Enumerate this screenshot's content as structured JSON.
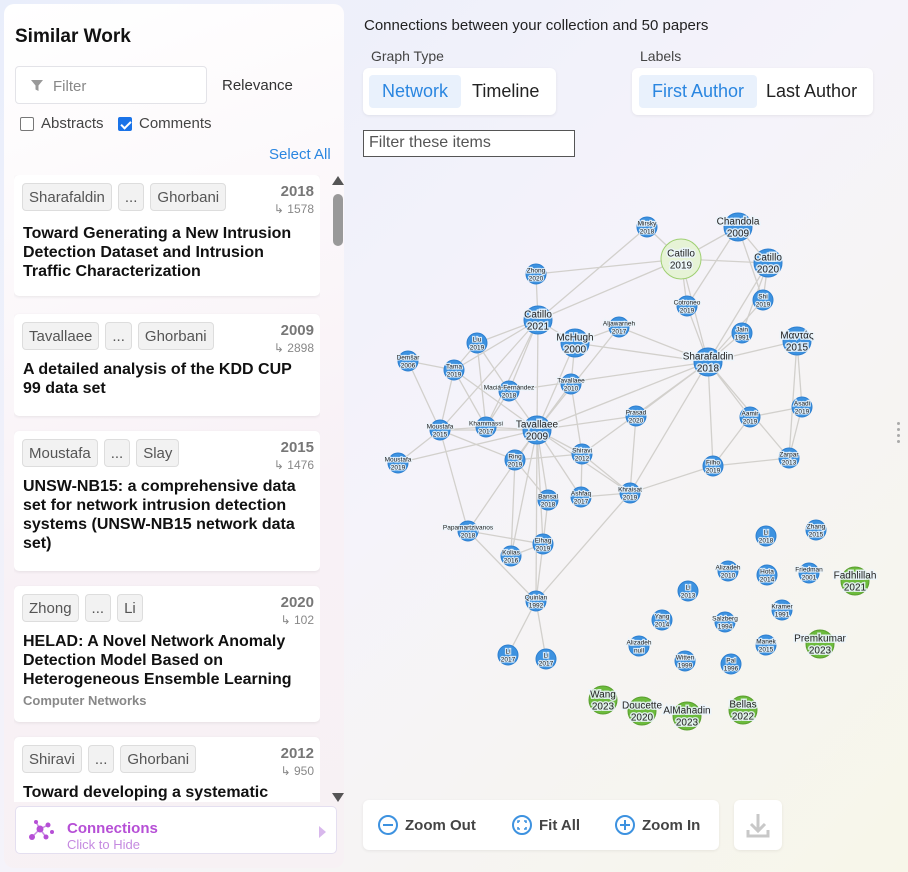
{
  "sidebar": {
    "title": "Similar Work",
    "filter_placeholder": "Filter",
    "sort_label": "Relevance",
    "abstracts_label": "Abstracts",
    "abstracts_checked": false,
    "comments_label": "Comments",
    "comments_checked": true,
    "select_all": "Select All",
    "cards": [
      {
        "first": "Sharafaldin",
        "ellipsis": "...",
        "last": "Ghorbani",
        "year": "2018",
        "cites": "↳ 1578",
        "title": "Toward Generating a New Intrusion Detection Dataset and Intrusion Traffic Characterization",
        "journal": ""
      },
      {
        "first": "Tavallaee",
        "ellipsis": "...",
        "last": "Ghorbani",
        "year": "2009",
        "cites": "↳ 2898",
        "title": "A detailed analysis of the KDD CUP 99 data set",
        "journal": ""
      },
      {
        "first": "Moustafa",
        "ellipsis": "...",
        "last": "Slay",
        "year": "2015",
        "cites": "↳ 1476",
        "title": "UNSW-NB15: a comprehensive data set for network intrusion detection systems (UNSW-NB15 network data set)",
        "journal": ""
      },
      {
        "first": "Zhong",
        "ellipsis": "...",
        "last": "Li",
        "year": "2020",
        "cites": "↳ 102",
        "title": "HELAD: A Novel Network Anomaly Detection Model Based on Heterogeneous Ensemble Learning",
        "journal": "Computer Networks"
      },
      {
        "first": "Shiravi",
        "ellipsis": "...",
        "last": "Ghorbani",
        "year": "2012",
        "cites": "↳ 950",
        "title": "Toward developing a systematic",
        "journal": ""
      }
    ],
    "connections": {
      "title": "Connections",
      "subtitle": "Click to Hide"
    }
  },
  "main": {
    "heading": "Connections between your collection and 50 papers",
    "graph_type_label": "Graph Type",
    "graph_types": [
      "Network",
      "Timeline"
    ],
    "graph_type_selected": "Network",
    "labels_label": "Labels",
    "label_options": [
      "First Author",
      "Last Author"
    ],
    "label_selected": "First Author",
    "filter_placeholder": "Filter these items",
    "zoom_out": "Zoom Out",
    "fit_all": "Fit All",
    "zoom_in": "Zoom In"
  },
  "colors": {
    "accent": "#2a86e0",
    "node_blue": "#3d92e0",
    "node_green": "#6cbb3c",
    "node_collection": "#e6f3d6",
    "connections_purple": "#b64fd6"
  },
  "graph": {
    "nodes": [
      {
        "id": "mirsky",
        "author": "Mirsky",
        "year": "2018",
        "kind": "b"
      },
      {
        "id": "chandola",
        "author": "Chandola",
        "year": "2009",
        "kind": "b"
      },
      {
        "id": "catillo19",
        "author": "Catillo",
        "year": "2019",
        "kind": "c"
      },
      {
        "id": "catillo20",
        "author": "Catillo",
        "year": "2020",
        "kind": "b"
      },
      {
        "id": "zhong",
        "author": "Zhong",
        "year": "2020",
        "kind": "b"
      },
      {
        "id": "shi",
        "author": "Shi",
        "year": "2019",
        "kind": "b"
      },
      {
        "id": "cotroneo",
        "author": "Cotroneo",
        "year": "2019",
        "kind": "b"
      },
      {
        "id": "catillo21",
        "author": "Catillo",
        "year": "2021",
        "kind": "b"
      },
      {
        "id": "aljawarneh",
        "author": "Aljawarneh",
        "year": "2017",
        "kind": "b"
      },
      {
        "id": "jain",
        "author": "Jain",
        "year": "1991",
        "kind": "b"
      },
      {
        "id": "mantas",
        "author": "Μαντάς",
        "year": "2015",
        "kind": "b"
      },
      {
        "id": "liu",
        "author": "Liu",
        "year": "2019",
        "kind": "b"
      },
      {
        "id": "mchugh",
        "author": "McHugh",
        "year": "2000",
        "kind": "b"
      },
      {
        "id": "sharafaldin",
        "author": "Sharafaldin",
        "year": "2018",
        "kind": "b"
      },
      {
        "id": "demsar",
        "author": "Demšar",
        "year": "2006",
        "kind": "b"
      },
      {
        "id": "tama",
        "author": "Tama",
        "year": "2019",
        "kind": "b"
      },
      {
        "id": "maciafernandez",
        "author": "Maciá-Fernández",
        "year": "2018",
        "kind": "b"
      },
      {
        "id": "tavallaee10",
        "author": "Tavallaee",
        "year": "2010",
        "kind": "b"
      },
      {
        "id": "prasad",
        "author": "Prasad",
        "year": "2020",
        "kind": "b"
      },
      {
        "id": "aamir",
        "author": "Aamir",
        "year": "2019",
        "kind": "b"
      },
      {
        "id": "asadi",
        "author": "Asadi",
        "year": "2019",
        "kind": "b"
      },
      {
        "id": "moustafa",
        "author": "Moustafa",
        "year": "2015",
        "kind": "b"
      },
      {
        "id": "khammassi",
        "author": "Khammassi",
        "year": "2017",
        "kind": "b"
      },
      {
        "id": "tavallaee09",
        "author": "Tavallaee",
        "year": "2009",
        "kind": "b"
      },
      {
        "id": "shiravi",
        "author": "Shiravi",
        "year": "2012",
        "kind": "b"
      },
      {
        "id": "zarpar",
        "author": "Zarpar",
        "year": "2013",
        "kind": "b"
      },
      {
        "id": "moustafa19",
        "author": "Moustafa",
        "year": "2019",
        "kind": "b"
      },
      {
        "id": "ring",
        "author": "Ring",
        "year": "2019",
        "kind": "b"
      },
      {
        "id": "filho",
        "author": "Filho",
        "year": "2019",
        "kind": "b"
      },
      {
        "id": "bansal",
        "author": "Bansal",
        "year": "2018",
        "kind": "b"
      },
      {
        "id": "ashfaq",
        "author": "Ashfaq",
        "year": "2017",
        "kind": "b"
      },
      {
        "id": "khraisat",
        "author": "Khraisat",
        "year": "2019",
        "kind": "b"
      },
      {
        "id": "papamartzivanos",
        "author": "Papamartzivanos",
        "year": "2018",
        "kind": "b"
      },
      {
        "id": "elhag",
        "author": "Elhag",
        "year": "2019",
        "kind": "b"
      },
      {
        "id": "li18",
        "author": "Li",
        "year": "2018",
        "kind": "b"
      },
      {
        "id": "zhang",
        "author": "Zhang",
        "year": "2015",
        "kind": "b"
      },
      {
        "id": "kolias",
        "author": "Kolias",
        "year": "2016",
        "kind": "b"
      },
      {
        "id": "alizadeh10",
        "author": "Alizadeh",
        "year": "2010",
        "kind": "b"
      },
      {
        "id": "hota",
        "author": "Hota",
        "year": "2014",
        "kind": "b"
      },
      {
        "id": "friedman",
        "author": "Friedman",
        "year": "2001",
        "kind": "b"
      },
      {
        "id": "fadhlillah",
        "author": "Fadhlillah",
        "year": "2021",
        "kind": "g"
      },
      {
        "id": "li13",
        "author": "Li",
        "year": "2013",
        "kind": "b"
      },
      {
        "id": "quinlan",
        "author": "Quinlan",
        "year": "1992",
        "kind": "b"
      },
      {
        "id": "kramer",
        "author": "Kramer",
        "year": "1991",
        "kind": "b"
      },
      {
        "id": "yang",
        "author": "Yang",
        "year": "2014",
        "kind": "b"
      },
      {
        "id": "salzberg",
        "author": "Salzberg",
        "year": "1994",
        "kind": "b"
      },
      {
        "id": "alizadehnull",
        "author": "Alizadeh",
        "year": "null",
        "kind": "b"
      },
      {
        "id": "manek",
        "author": "Manek",
        "year": "2015",
        "kind": "b"
      },
      {
        "id": "premkumar",
        "author": "Premkumar",
        "year": "2023",
        "kind": "g"
      },
      {
        "id": "li17a",
        "author": "Li",
        "year": "2017",
        "kind": "b"
      },
      {
        "id": "li17b",
        "author": "Li",
        "year": "2017",
        "kind": "b"
      },
      {
        "id": "witten",
        "author": "Witten",
        "year": "1999",
        "kind": "b"
      },
      {
        "id": "pal",
        "author": "Pal",
        "year": "1996",
        "kind": "b"
      },
      {
        "id": "wang",
        "author": "Wang",
        "year": "2023",
        "kind": "g"
      },
      {
        "id": "doucette",
        "author": "Doucette",
        "year": "2020",
        "kind": "g"
      },
      {
        "id": "almahadin",
        "author": "AlMahadin",
        "year": "2023",
        "kind": "g"
      },
      {
        "id": "bellas",
        "author": "Bellas",
        "year": "2022",
        "kind": "g"
      }
    ],
    "edges": [
      [
        "mirsky",
        "catillo19"
      ],
      [
        "chandola",
        "catillo19"
      ],
      [
        "catillo20",
        "catillo19"
      ],
      [
        "zhong",
        "catillo19"
      ],
      [
        "chandola",
        "catillo20"
      ],
      [
        "chandola",
        "shi"
      ],
      [
        "chandola",
        "cotroneo"
      ],
      [
        "catillo19",
        "cotroneo"
      ],
      [
        "catillo19",
        "catillo21"
      ],
      [
        "catillo19",
        "sharafaldin"
      ],
      [
        "catillo20",
        "shi"
      ],
      [
        "catillo20",
        "sharafaldin"
      ],
      [
        "shi",
        "sharafaldin"
      ],
      [
        "mirsky",
        "catillo21"
      ],
      [
        "cotroneo",
        "sharafaldin"
      ],
      [
        "catillo21",
        "mchugh"
      ],
      [
        "catillo21",
        "tavallaee09"
      ],
      [
        "catillo21",
        "khammassi"
      ],
      [
        "catillo21",
        "maciafernandez"
      ],
      [
        "catillo21",
        "liu"
      ],
      [
        "catillo21",
        "tama"
      ],
      [
        "catillo21",
        "moustafa"
      ],
      [
        "mchugh",
        "tavallaee09"
      ],
      [
        "mchugh",
        "sharafaldin"
      ],
      [
        "mchugh",
        "aljawarneh"
      ],
      [
        "mchugh",
        "tavallaee10"
      ],
      [
        "aljawarneh",
        "sharafaldin"
      ],
      [
        "aljawarneh",
        "tavallaee09"
      ],
      [
        "jain",
        "sharafaldin"
      ],
      [
        "mantas",
        "sharafaldin"
      ],
      [
        "mantas",
        "asadi"
      ],
      [
        "sharafaldin",
        "tavallaee09"
      ],
      [
        "sharafaldin",
        "shiravi"
      ],
      [
        "sharafaldin",
        "aamir"
      ],
      [
        "sharafaldin",
        "filho"
      ],
      [
        "sharafaldin",
        "prasad"
      ],
      [
        "sharafaldin",
        "khraisat"
      ],
      [
        "sharafaldin",
        "maciafernandez"
      ],
      [
        "sharafaldin",
        "zarpar"
      ],
      [
        "demsar",
        "tama"
      ],
      [
        "demsar",
        "moustafa"
      ],
      [
        "tama",
        "khammassi"
      ],
      [
        "tama",
        "moustafa"
      ],
      [
        "liu",
        "tama"
      ],
      [
        "liu",
        "maciafernandez"
      ],
      [
        "maciafernandez",
        "tavallaee09"
      ],
      [
        "tavallaee10",
        "tavallaee09"
      ],
      [
        "tavallaee10",
        "shiravi"
      ],
      [
        "tavallaee09",
        "moustafa"
      ],
      [
        "tavallaee09",
        "khammassi"
      ],
      [
        "tavallaee09",
        "shiravi"
      ],
      [
        "tavallaee09",
        "ring"
      ],
      [
        "tavallaee09",
        "prasad"
      ],
      [
        "tavallaee09",
        "bansal"
      ],
      [
        "tavallaee09",
        "ashfaq"
      ],
      [
        "tavallaee09",
        "khraisat"
      ],
      [
        "tavallaee09",
        "elhag"
      ],
      [
        "tavallaee09",
        "quinlan"
      ],
      [
        "tavallaee09",
        "papamartzivanos"
      ],
      [
        "tavallaee09",
        "kolias"
      ],
      [
        "moustafa",
        "khammassi"
      ],
      [
        "moustafa",
        "ring"
      ],
      [
        "moustafa19",
        "moustafa"
      ],
      [
        "moustafa19",
        "tavallaee09"
      ],
      [
        "shiravi",
        "ring"
      ],
      [
        "shiravi",
        "khraisat"
      ],
      [
        "shiravi",
        "ashfaq"
      ],
      [
        "ring",
        "bansal"
      ],
      [
        "ring",
        "kolias"
      ],
      [
        "filho",
        "zarpar"
      ],
      [
        "filho",
        "khraisat"
      ],
      [
        "filho",
        "aamir"
      ],
      [
        "zarpar",
        "asadi"
      ],
      [
        "mantas",
        "zarpar"
      ],
      [
        "aamir",
        "asadi"
      ],
      [
        "prasad",
        "khraisat"
      ],
      [
        "khraisat",
        "ashfaq"
      ],
      [
        "khraisat",
        "quinlan"
      ],
      [
        "papamartzivanos",
        "elhag"
      ],
      [
        "papamartzivanos",
        "quinlan"
      ],
      [
        "elhag",
        "quinlan"
      ],
      [
        "quinlan",
        "li17a"
      ],
      [
        "quinlan",
        "li17b"
      ],
      [
        "kolias",
        "elhag"
      ],
      [
        "bansal",
        "elhag"
      ],
      [
        "moustafa",
        "papamartzivanos"
      ],
      [
        "jain",
        "catillo20"
      ],
      [
        "tama",
        "tavallaee09"
      ],
      [
        "liu",
        "khammassi"
      ],
      [
        "maciafernandez",
        "khammassi"
      ],
      [
        "zhong",
        "catillo21"
      ]
    ]
  }
}
